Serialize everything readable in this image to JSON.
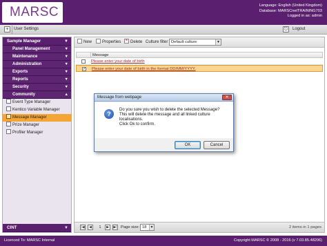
{
  "header": {
    "logo_text": "MARSC",
    "language_line": "Language: English (United Kingdom)",
    "database_line": "Database: MARSCnetTRAINING703",
    "logged_in_line": "Logged in as: admin"
  },
  "toolbar": {
    "user_settings_label": "User Settings",
    "logout_label": "Logout"
  },
  "sidebar": {
    "section_title": "Sample Manager",
    "groups": [
      {
        "label": "Panel Management"
      },
      {
        "label": "Maintenance"
      },
      {
        "label": "Administration"
      },
      {
        "label": "Exports"
      },
      {
        "label": "Reports"
      },
      {
        "label": "Security"
      },
      {
        "label": "Community"
      }
    ],
    "items": [
      {
        "label": "Event Type Manager"
      },
      {
        "label": "Kentico Variable Manager"
      },
      {
        "label": "Message Manager",
        "selected": true
      },
      {
        "label": "Prize Manager"
      },
      {
        "label": "Profiler Manager"
      }
    ],
    "bottom_section": "CINT"
  },
  "content_toolbar": {
    "new_label": "New",
    "properties_label": "Properties",
    "delete_label": "Delete",
    "culture_filter_label": "Culture filter",
    "culture_value": "Default culture"
  },
  "grid": {
    "column_header": "Message",
    "rows": [
      {
        "message": "Please enter your date of birth",
        "checked": false
      },
      {
        "message": "Please enter your date of birth in the format DD/MM/YYYY.",
        "checked": true
      }
    ]
  },
  "pager": {
    "current_page": "1",
    "page_size_label": "Page size:",
    "page_size_value": "18",
    "items_info": "2 items in 1 pages"
  },
  "footer": {
    "licence": "Licenced To: MARSC Internal",
    "copyright": "Copyright MARSC © 2008 - 2016 (v 7.03.85.48206)"
  },
  "dialog": {
    "title": "Message from webpage",
    "line1": "Do you sure you wish to delete the selected Message?",
    "line2": "This will delete the message and all linked culture localisations.",
    "line3": "Click Ok to confirm.",
    "ok_label": "OK",
    "cancel_label": "Cancel"
  },
  "colors": {
    "brand_purple": "#5a1f6e",
    "selection_orange": "#f3a535"
  }
}
